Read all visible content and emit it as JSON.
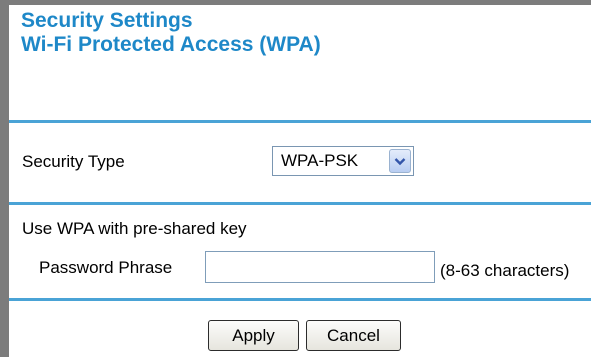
{
  "header": {
    "title_line_1": "Security Settings",
    "title_line_2": "Wi-Fi Protected Access (WPA)"
  },
  "security": {
    "type_label": "Security Type",
    "type_selected": "WPA-PSK"
  },
  "wpa": {
    "description": "Use WPA with pre-shared key",
    "password_label": "Password Phrase",
    "password_value": "",
    "password_hint": "(8-63 characters)"
  },
  "actions": {
    "apply_label": "Apply",
    "cancel_label": "Cancel"
  },
  "colors": {
    "title": "#1e88c8",
    "divider": "#4aa3d6",
    "frame": "#7c7c7c"
  },
  "icons": {
    "select_arrow": "chevron-down-icon"
  }
}
